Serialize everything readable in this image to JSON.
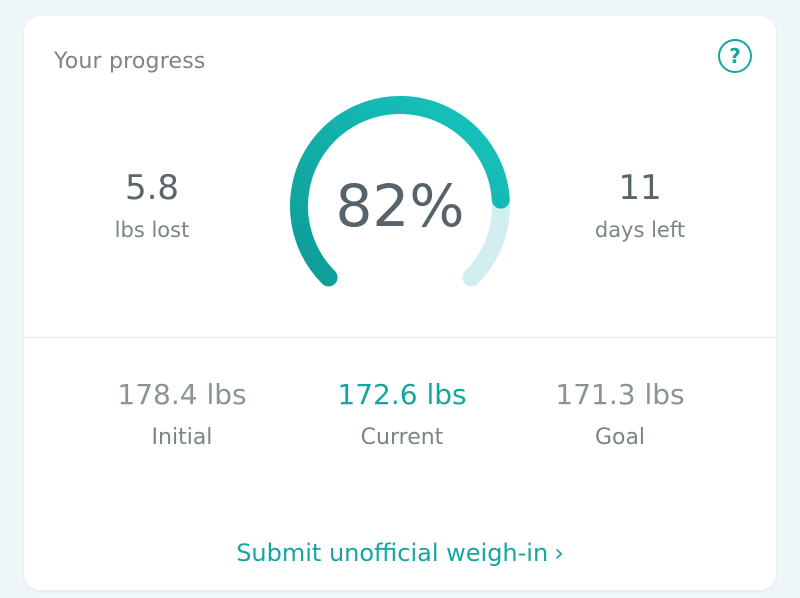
{
  "card": {
    "title": "Your progress",
    "help_icon": "help-question-icon",
    "help_glyph": "?"
  },
  "stats": {
    "lost": {
      "value": "5.8",
      "label": "lbs lost"
    },
    "days": {
      "value": "11",
      "label": "days left"
    }
  },
  "gauge": {
    "percent_label": "82%",
    "progress": 0.82,
    "colors": {
      "fill_start": "#0f9b97",
      "fill_end": "#17c6bf",
      "track": "#d3eeee"
    }
  },
  "weights": {
    "initial": {
      "value": "178.4 lbs",
      "label": "Initial"
    },
    "current": {
      "value": "172.6 lbs",
      "label": "Current"
    },
    "goal": {
      "value": "171.3 lbs",
      "label": "Goal"
    }
  },
  "action": {
    "label": "Submit unofficial weigh-in",
    "chevron_icon": "chevron-right-icon",
    "chevron_glyph": "›"
  },
  "colors": {
    "accent": "#16a59f",
    "text_dark": "#56636a",
    "text_muted": "#7b8588"
  }
}
